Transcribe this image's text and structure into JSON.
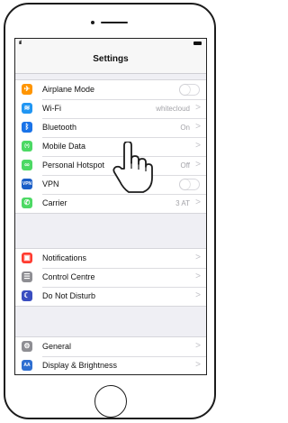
{
  "colors": {
    "airplane": "#ff9500",
    "wifi": "#2196f3",
    "bluetooth": "#1a73e8",
    "mobile_data": "#4cd964",
    "hotspot": "#4cd964",
    "vpn": "#1a5ec7",
    "carrier": "#4cd964",
    "notifications": "#ff3b30",
    "control_centre": "#8e8e93",
    "do_not_disturb": "#3a4ec0",
    "general": "#8e8e93",
    "display": "#2f6fd1"
  },
  "nav": {
    "title": "Settings"
  },
  "groups": [
    {
      "rows": [
        {
          "label": "Airplane Mode",
          "icon": "airplane-icon",
          "glyph": "✈",
          "toggle": "off"
        },
        {
          "label": "Wi-Fi",
          "icon": "wifi-icon",
          "glyph": "≋",
          "value": "whitecloud",
          "chevron": ">"
        },
        {
          "label": "Bluetooth",
          "icon": "bluetooth-icon",
          "glyph": "ᛒ",
          "value": "On",
          "chevron": ">"
        },
        {
          "label": "Mobile Data",
          "icon": "antenna-icon",
          "glyph": "(ᵒ)",
          "chevron": ">"
        },
        {
          "label": "Personal Hotspot",
          "icon": "hotspot-icon",
          "glyph": "∞",
          "value": "Off",
          "chevron": ">"
        },
        {
          "label": "VPN",
          "icon": "vpn-icon",
          "glyph": "VPN",
          "toggle": "off"
        },
        {
          "label": "Carrier",
          "icon": "phone-icon",
          "glyph": "✆",
          "value": "3 AT",
          "chevron": ">"
        }
      ]
    },
    {
      "rows": [
        {
          "label": "Notifications",
          "icon": "notifications-icon",
          "glyph": "▣",
          "chevron": ">"
        },
        {
          "label": "Control Centre",
          "icon": "control-centre-icon",
          "glyph": "☰",
          "chevron": ">"
        },
        {
          "label": "Do Not Disturb",
          "icon": "moon-icon",
          "glyph": "☾",
          "chevron": ">"
        }
      ]
    },
    {
      "rows": [
        {
          "label": "General",
          "icon": "gear-icon",
          "glyph": "⚙",
          "chevron": ">"
        },
        {
          "label": "Display & Brightness",
          "icon": "display-icon",
          "glyph": "AA",
          "chevron": ">"
        }
      ]
    }
  ]
}
